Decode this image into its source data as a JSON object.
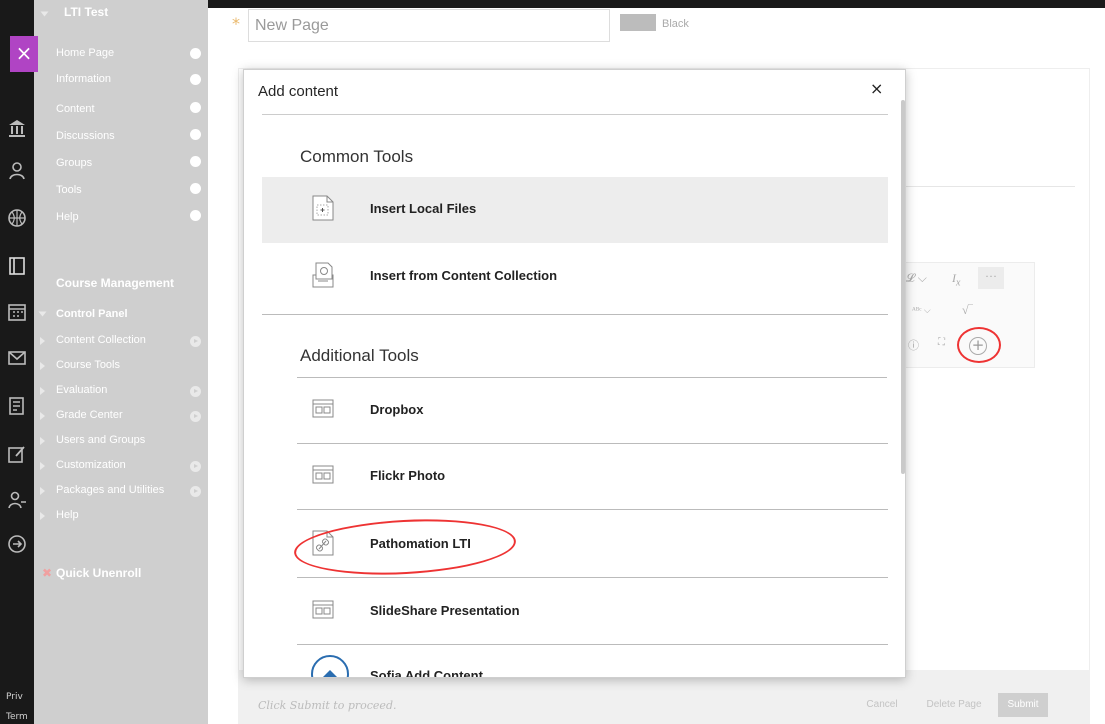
{
  "menu": {
    "course_title": "LTI Test",
    "items": [
      {
        "label": "Home Page"
      },
      {
        "label": "Information"
      },
      {
        "label": "Content"
      },
      {
        "label": "Discussions"
      },
      {
        "label": "Groups"
      },
      {
        "label": "Tools"
      },
      {
        "label": "Help"
      }
    ],
    "management_header": "Course Management",
    "control_panel": "Control Panel",
    "cp_items": [
      {
        "label": "Content Collection"
      },
      {
        "label": "Course Tools"
      },
      {
        "label": "Evaluation"
      },
      {
        "label": "Grade Center"
      },
      {
        "label": "Users and Groups"
      },
      {
        "label": "Customization"
      },
      {
        "label": "Packages and Utilities"
      },
      {
        "label": "Help"
      }
    ],
    "quick_unenroll": "Quick Unenroll"
  },
  "rail": {
    "footer_1": "Priv",
    "footer_2": "Term"
  },
  "editor": {
    "title_placeholder": "New Page",
    "color_label": "Black",
    "footer_hint": "Click Submit to proceed.",
    "cancel": "Cancel",
    "delete_page": "Delete Page",
    "submit": "Submit"
  },
  "modal": {
    "title": "Add content",
    "close": "×",
    "common_header": "Common Tools",
    "common_tools": [
      {
        "label": "Insert Local Files",
        "icon": "file-plus-icon"
      },
      {
        "label": "Insert from Content Collection",
        "icon": "content-collection-icon"
      }
    ],
    "additional_header": "Additional Tools",
    "additional_tools": [
      {
        "label": "Dropbox",
        "icon": "app-window-icon"
      },
      {
        "label": "Flickr Photo",
        "icon": "app-window-icon"
      },
      {
        "label": "Pathomation LTI",
        "icon": "link-file-icon"
      },
      {
        "label": "SlideShare Presentation",
        "icon": "app-window-icon"
      },
      {
        "label": "Sofia Add Content",
        "icon": "sofia-logo-icon"
      }
    ]
  },
  "colors": {
    "accent_purple": "#b044c4",
    "annotation_red": "#e33333",
    "menu_bg": "#cfcfcf"
  }
}
